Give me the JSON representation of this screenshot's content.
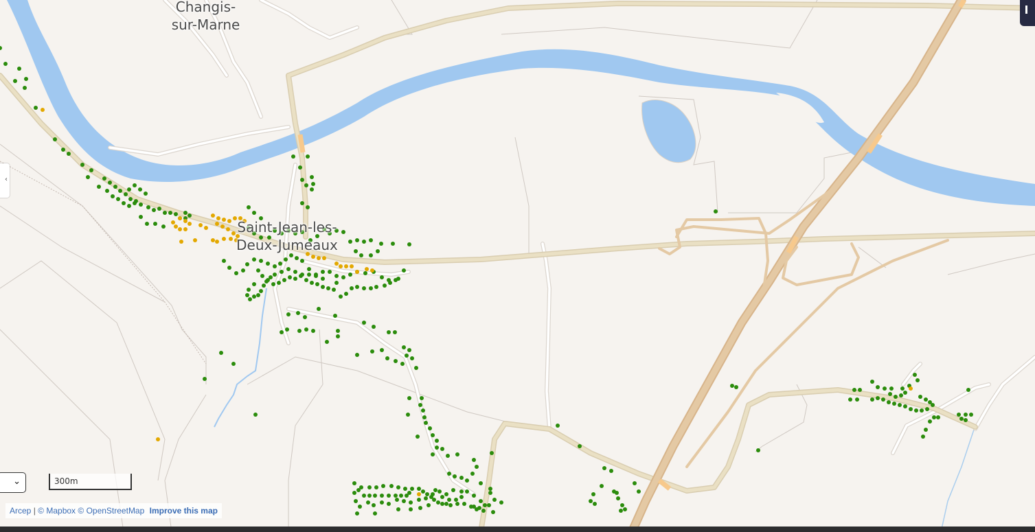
{
  "map": {
    "places": {
      "changis_line1": "Changis-",
      "changis_line2": "sur-Marne",
      "saint_jean_line1": "Saint-Jean-les-",
      "saint_jean_line2": "Deux-Jumeaux"
    },
    "colors": {
      "land": "#f6f3ef",
      "water": "#a0c8f0",
      "road_minor": "#ffffff",
      "road_minor_casing": "#dcd6cf",
      "road_main": "#eae0c4",
      "motorway": "#e2c7a2",
      "bridge": "#f7c98c",
      "point_green": "#2b8c0c",
      "point_orange": "#e3a800",
      "boundary": "#c8bfb8"
    },
    "layers": {
      "green_points_label": "green-markers",
      "orange_points_label": "orange-markers"
    }
  },
  "controls": {
    "layer_select_value": "",
    "scale_label": "300m"
  },
  "attribution": {
    "arcep": "Arcep",
    "separator": "|",
    "mapbox": "© Mapbox",
    "osm": "© OpenStreetMap",
    "improve": "Improve this map"
  }
}
